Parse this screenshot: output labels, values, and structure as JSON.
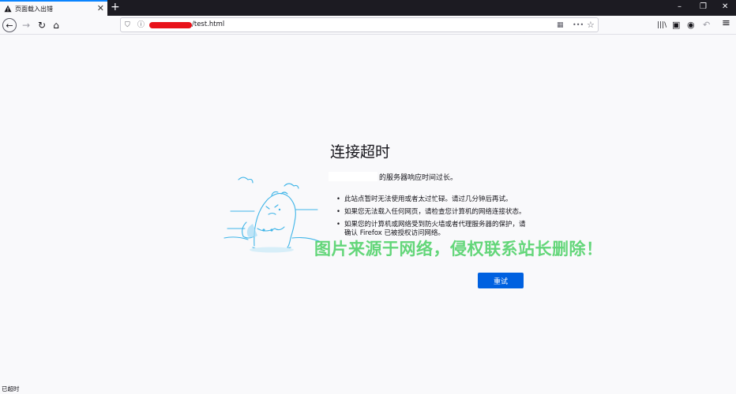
{
  "browser": {
    "tab": {
      "title": "页面载入出错",
      "close_glyph": "✕"
    },
    "new_tab_glyph": "+",
    "window_controls": {
      "minimize": "–",
      "restore": "❐",
      "close": "✕"
    },
    "nav": {
      "back": "←",
      "forward": "→",
      "reload": "↻",
      "home": "⌂"
    },
    "url": {
      "path": "/test.html",
      "shield": "⛉",
      "info": "ⓘ"
    },
    "url_actions": {
      "qr": "▦",
      "more": "•••",
      "bookmark": "☆"
    },
    "toolbar": {
      "library": "|||\\",
      "sidebar": "▣",
      "account": "◉",
      "undo": "↶",
      "menu": "≡"
    }
  },
  "error_page": {
    "title": "连接超时",
    "description": "的服务器响应时间过长。",
    "bullets": [
      "此站点暂时无法使用或者太过忙碌。请过几分钟后再试。",
      "如果您无法载入任何网页，请检查您计算机的网络连接状态。",
      "如果您的计算机或网络受到防火墙或者代理服务器的保护，请确认 Firefox 已被授权访问网络。"
    ],
    "retry_label": "重试"
  },
  "watermark": "图片来源于网络，侵权联系站长删除！",
  "status_bar": "已超时",
  "colors": {
    "accent": "#0061e0",
    "tab_accent": "#0a84ff",
    "titlebar": "#1c1b22",
    "watermark": "#28c846",
    "illustration": "#3fb5e8"
  }
}
